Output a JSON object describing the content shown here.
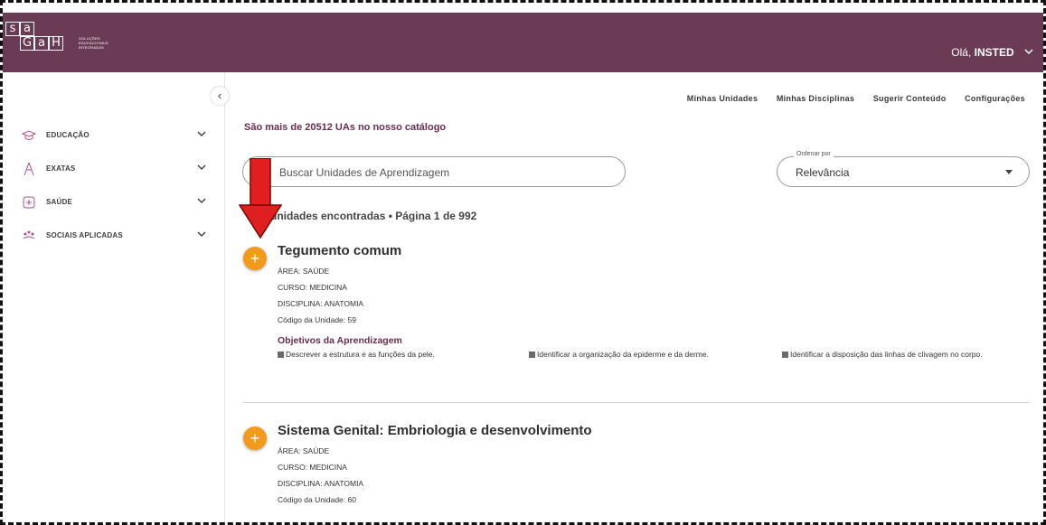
{
  "header": {
    "logo_letters": [
      "s",
      "a",
      "G",
      "a",
      "H"
    ],
    "logo_tagline": "SOLUÇÕES EDUCACIONAIS INTEGRADAS",
    "greeting": "Olá,",
    "user_name": "INSTED",
    "colors": {
      "brand": "#6b3a55",
      "accent": "#f39a1b"
    }
  },
  "sidebar": {
    "items": [
      {
        "label": "EDUCAÇÃO",
        "icon": "graduation-cap-icon",
        "icon_color": "#b44b86"
      },
      {
        "label": "EXATAS",
        "icon": "compass-icon",
        "icon_color": "#b44b86"
      },
      {
        "label": "SAÚDE",
        "icon": "health-icon",
        "icon_color": "#b44b86"
      },
      {
        "label": "SOCIAIS APLICADAS",
        "icon": "people-icon",
        "icon_color": "#b44b86"
      }
    ]
  },
  "topnav": [
    "Minhas Unidades",
    "Minhas Disciplinas",
    "Sugerir Conteúdo",
    "Configurações"
  ],
  "catalog_title": "São mais de 20512 UAs no nosso catálogo",
  "search": {
    "placeholder": "Buscar Unidades de Aprendizagem"
  },
  "order": {
    "legend": "Ordenar por",
    "value": "Relevância"
  },
  "results": {
    "count_text": "unidades encontradas • Página ",
    "page": "1",
    "of_text": " de ",
    "total_pages": "992"
  },
  "units": [
    {
      "title": "Tegumento comum",
      "area": "ÁREA: SAÚDE",
      "curso": "CURSO: MEDICINA",
      "disciplina": "DISCIPLINA: ANATOMIA",
      "codigo": "Código da Unidade: 59",
      "objectives_title": "Objetivos da Aprendizagem",
      "objectives": [
        "Descrever a estrutura e as funções da pele.",
        "Identificar a organização da epiderme e da derme.",
        "Identificar a disposição das linhas de clivagem no corpo."
      ]
    },
    {
      "title": "Sistema Genital: Embriologia e desenvolvimento",
      "area": "ÁREA: SAÚDE",
      "curso": "CURSO: MEDICINA",
      "disciplina": "DISCIPLINA: ANATOMIA",
      "codigo": "Código da Unidade: 60"
    }
  ]
}
